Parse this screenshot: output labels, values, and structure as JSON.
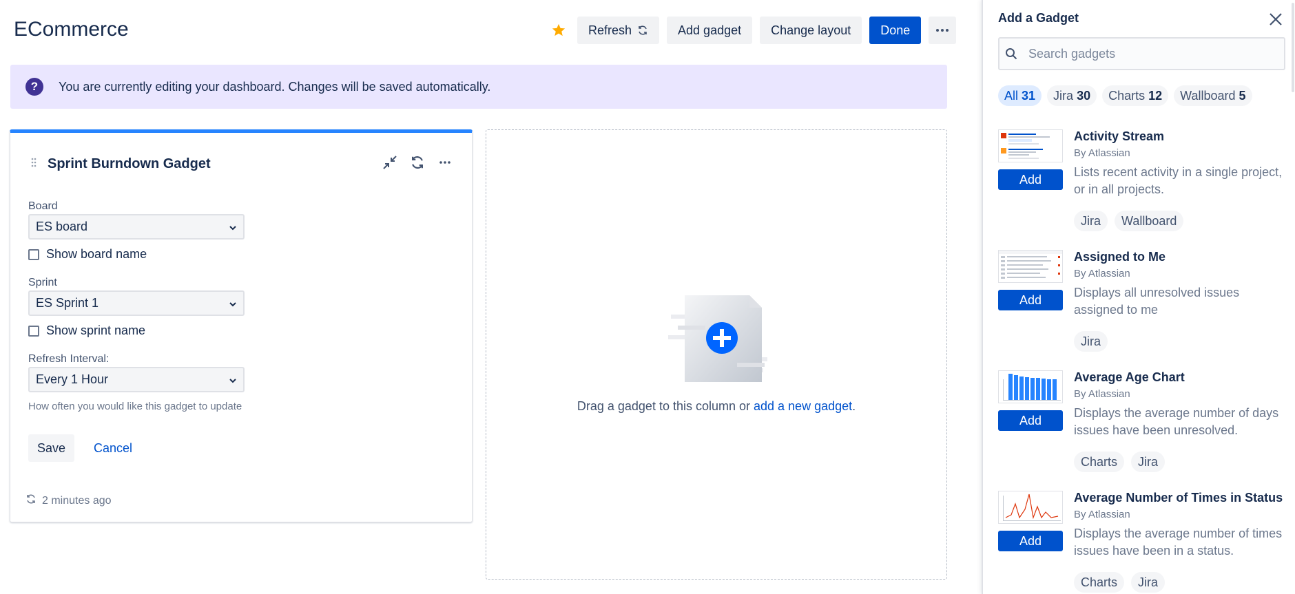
{
  "header": {
    "title": "ECommerce",
    "refresh_label": "Refresh",
    "add_gadget_label": "Add gadget",
    "change_layout_label": "Change layout",
    "done_label": "Done"
  },
  "banner": {
    "text": "You are currently editing your dashboard. Changes will be saved automatically."
  },
  "gadget": {
    "title": "Sprint Burndown Gadget",
    "board_label": "Board",
    "board_value": "ES board",
    "show_board_name_label": "Show board name",
    "sprint_label": "Sprint",
    "sprint_value": "ES Sprint 1",
    "show_sprint_name_label": "Show sprint name",
    "refresh_interval_label": "Refresh Interval:",
    "refresh_interval_value": "Every 1 Hour",
    "helper_text": "How often you would like this gadget to update",
    "save_label": "Save",
    "cancel_label": "Cancel",
    "updated_text": "2 minutes ago"
  },
  "dropzone": {
    "text_before": "Drag a gadget to this column or ",
    "link_text": "add a new gadget",
    "text_after": "."
  },
  "panel": {
    "title": "Add a Gadget",
    "search_placeholder": "Search gadgets",
    "filters": [
      {
        "label": "All",
        "count": "31"
      },
      {
        "label": "Jira",
        "count": "30"
      },
      {
        "label": "Charts",
        "count": "12"
      },
      {
        "label": "Wallboard",
        "count": "5"
      }
    ],
    "add_label": "Add",
    "items": [
      {
        "name": "Activity Stream",
        "by": "By Atlassian",
        "desc": "Lists recent activity in a single project, or in all projects.",
        "tags": [
          "Jira",
          "Wallboard"
        ]
      },
      {
        "name": "Assigned to Me",
        "by": "By Atlassian",
        "desc": "Displays all unresolved issues assigned to me",
        "tags": [
          "Jira"
        ]
      },
      {
        "name": "Average Age Chart",
        "by": "By Atlassian",
        "desc": "Displays the average number of days issues have been unresolved.",
        "tags": [
          "Charts",
          "Jira"
        ]
      },
      {
        "name": "Average Number of Times in Status",
        "by": "By Atlassian",
        "desc": "Displays the average number of times issues have been in a status.",
        "tags": [
          "Charts",
          "Jira"
        ]
      }
    ]
  },
  "colors": {
    "primary": "#0052cc",
    "accent_bar": "#2684ff",
    "banner_bg": "#eae6ff",
    "banner_icon": "#403294",
    "star": "#ffab00"
  },
  "icons": [
    "star-icon",
    "refresh-icon",
    "more-icon",
    "help-icon",
    "drag-handle-icon",
    "minimize-icon",
    "close-icon",
    "search-icon",
    "chevron-down-icon"
  ]
}
